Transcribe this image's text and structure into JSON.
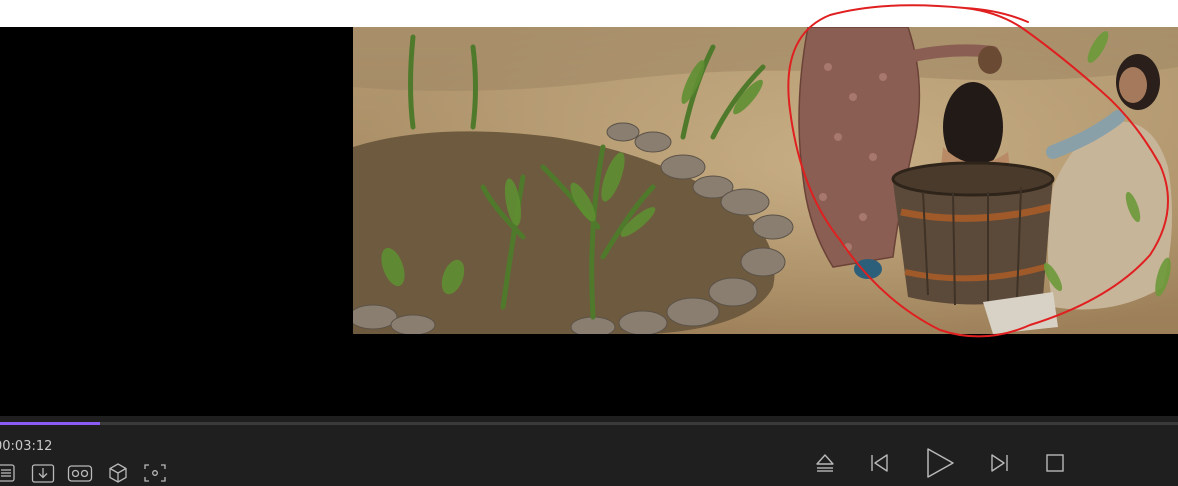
{
  "player": {
    "current_time": "00:03:12",
    "progress_percent": 8.5
  },
  "colors": {
    "control_bar": "#1f1f1f",
    "progress_accent": "#8b5cf6",
    "annotation_stroke": "#e02020",
    "icon": "#b9b9b9"
  },
  "left_tools": [
    {
      "name": "playlist-icon"
    },
    {
      "name": "download-icon"
    },
    {
      "name": "vr-goggles-icon"
    },
    {
      "name": "3d-cube-icon"
    },
    {
      "name": "screenshot-icon"
    }
  ],
  "transport_controls": [
    {
      "name": "eject-icon"
    },
    {
      "name": "previous-icon"
    },
    {
      "name": "play-icon"
    },
    {
      "name": "next-icon"
    },
    {
      "name": "stop-icon"
    }
  ]
}
